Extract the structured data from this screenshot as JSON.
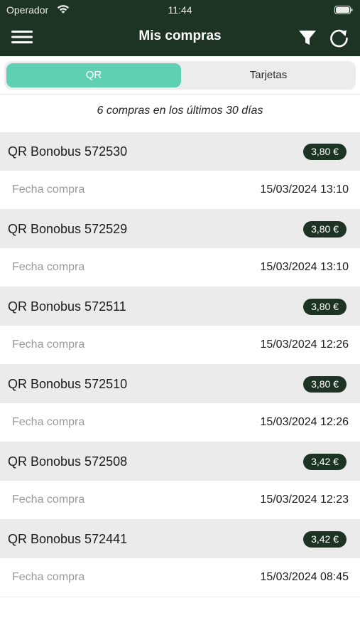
{
  "status_bar": {
    "carrier": "Operador",
    "time": "11:44"
  },
  "header": {
    "title": "Mis compras"
  },
  "tabs": [
    {
      "label": "QR",
      "active": true
    },
    {
      "label": "Tarjetas",
      "active": false
    }
  ],
  "summary": "6 compras en los últimos 30 días",
  "colors": {
    "header_bg": "#1d3324",
    "accent": "#5fd0b2",
    "price_bg": "#1d3324"
  },
  "purchases": [
    {
      "title": "QR Bonobus 572530",
      "price": "3,80 €",
      "date_label": "Fecha compra",
      "date": "15/03/2024 13:10"
    },
    {
      "title": "QR Bonobus 572529",
      "price": "3,80 €",
      "date_label": "Fecha compra",
      "date": "15/03/2024 13:10"
    },
    {
      "title": "QR Bonobus 572511",
      "price": "3,80 €",
      "date_label": "Fecha compra",
      "date": "15/03/2024 12:26"
    },
    {
      "title": "QR Bonobus 572510",
      "price": "3,80 €",
      "date_label": "Fecha compra",
      "date": "15/03/2024 12:26"
    },
    {
      "title": "QR Bonobus 572508",
      "price": "3,42 €",
      "date_label": "Fecha compra",
      "date": "15/03/2024 12:23"
    },
    {
      "title": "QR Bonobus 572441",
      "price": "3,42 €",
      "date_label": "Fecha compra",
      "date": "15/03/2024 08:45"
    }
  ]
}
